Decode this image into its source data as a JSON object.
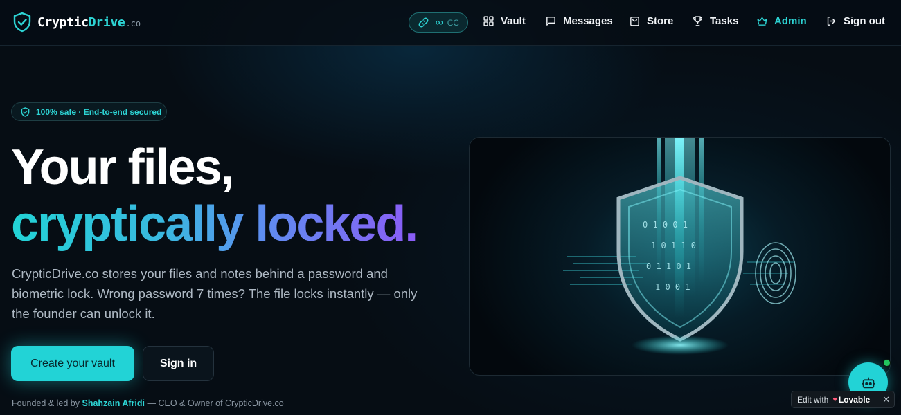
{
  "brand": {
    "name_main": "Cryptic",
    "name_accent": "Drive",
    "tld": ".co"
  },
  "nav": {
    "pill": {
      "infinity": "∞",
      "label": "CC"
    },
    "items": [
      {
        "label": "Vault",
        "icon": "grid-icon"
      },
      {
        "label": "Messages",
        "icon": "message-icon"
      },
      {
        "label": "Store",
        "icon": "store-icon"
      },
      {
        "label": "Tasks",
        "icon": "trophy-icon"
      },
      {
        "label": "Admin",
        "icon": "crown-icon"
      },
      {
        "label": "Sign out",
        "icon": "sign-out-icon"
      }
    ]
  },
  "hero": {
    "badge": "100% safe · End-to-end secured",
    "headline_line1": "Your files,",
    "headline_line2": "cryptically locked.",
    "lead": "CrypticDrive.co stores your files and notes behind a password and biometric lock. Wrong password 7 times? The file locks instantly — only the founder can unlock it.",
    "primary_cta": "Create your vault",
    "secondary_cta": "Sign in",
    "founder_prefix": "Founded & led by",
    "founder_name": "Shahzain Afridi",
    "founder_suffix": "— CEO & Owner of CrypticDrive.co",
    "image_alt": "shield-lock-illustration"
  },
  "widget": {
    "edit_with": "Edit with",
    "lovable": "Lovable",
    "close": "✕"
  },
  "colors": {
    "accent": "#22d3d6",
    "gradient_end": "#8b5cf6",
    "background": "#060d14"
  }
}
